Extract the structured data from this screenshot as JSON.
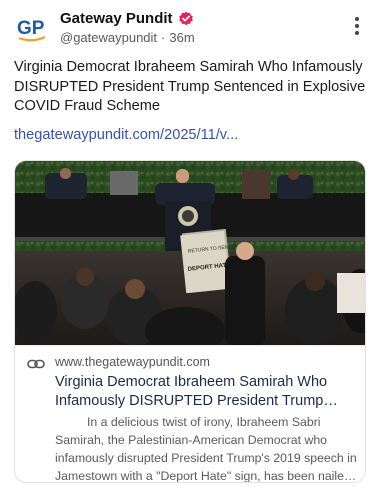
{
  "post": {
    "author": {
      "display_name": "Gateway Pundit",
      "handle": "@gatewaypundit",
      "time_ago": "36m",
      "avatar_text": "GP",
      "verified": true
    },
    "text": "Virginia Democrat Ibraheem Samirah Who Infamously DISRUPTED President Trump Sentenced in Explosive COVID Fraud Scheme",
    "link_text": "thegatewaypundit.com/2025/11/v..."
  },
  "link_card": {
    "domain": "www.thegatewaypundit.com",
    "title": "Virginia Democrat Ibraheem Samirah Who Infamously DISRUPTED President Trump Sentenced in Explosive COVID Fraud Scheme",
    "description": "In a delicious twist of irony, Ibraheem Sabri Samirah, the Palestinian-American Democrat who infamously disrupted President Trump's 2019 speech in Jamestown with a \"Deport Hate\" sign, has been nailed for his role in an explosive COVID fraud scheme.",
    "image_sign_text": "DEPORT HATE",
    "image_sign_subtext": "RETURN TO SENDER"
  },
  "colors": {
    "link": "#3552a8",
    "verified_badge": "#e0245e",
    "avatar_brand": "#1e5aa8",
    "avatar_accent": "#f2a21c"
  },
  "icons": {
    "verified": "verified-badge-icon",
    "more": "more-vertical-icon",
    "link": "link-chain-icon"
  }
}
